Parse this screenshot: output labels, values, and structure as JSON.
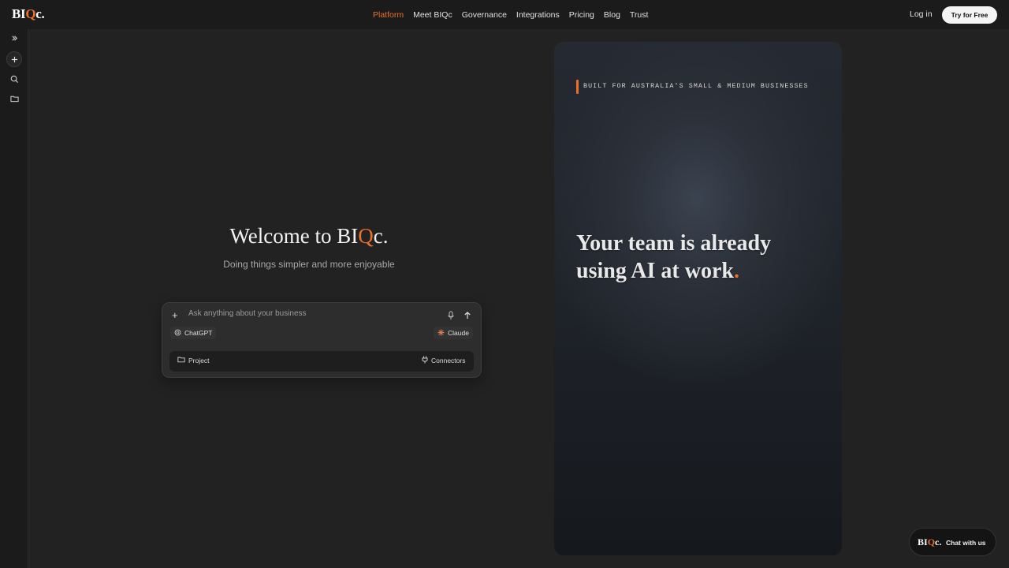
{
  "brand": {
    "logo_prefix": "BI",
    "logo_q": "Q",
    "logo_suffix": "c.",
    "accent_color": "#e8702a"
  },
  "nav": {
    "items": [
      {
        "label": "Platform",
        "active": true
      },
      {
        "label": "Meet BIQc",
        "active": false
      },
      {
        "label": "Governance",
        "active": false
      },
      {
        "label": "Integrations",
        "active": false
      },
      {
        "label": "Pricing",
        "active": false
      },
      {
        "label": "Blog",
        "active": false
      },
      {
        "label": "Trust",
        "active": false
      }
    ],
    "login_label": "Log in",
    "cta_label": "Try for Free"
  },
  "rail": {
    "icons": [
      "expand-chevrons-icon",
      "plus-icon",
      "search-icon",
      "folder-icon"
    ]
  },
  "hero": {
    "welcome_prefix": "Welcome to BI",
    "welcome_q": "Q",
    "welcome_suffix": "c.",
    "subtitle": "Doing things simpler and more enjoyable"
  },
  "composer": {
    "placeholder": "Ask anything about your business",
    "chatgpt_label": "ChatGPT",
    "claude_label": "Claude",
    "project_label": "Project",
    "connectors_label": "Connectors"
  },
  "card": {
    "tagline": "BUILT FOR AUSTRALIA'S SMALL & MEDIUM BUSINESSES",
    "headline_line1": "Your team is already",
    "headline_line2": "using AI at work",
    "headline_dot": "."
  },
  "chat_widget": {
    "logo_prefix": "BI",
    "logo_q": "Q",
    "logo_suffix": "c.",
    "label": "Chat with us"
  }
}
